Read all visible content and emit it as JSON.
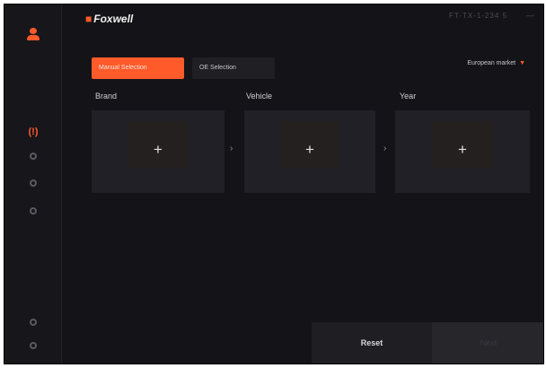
{
  "app": {
    "logo_text": "Foxwell"
  },
  "header": {
    "serial_text": "FT-TX-1-234 5",
    "window_control": "—"
  },
  "tabs": [
    {
      "label": "Manual Selection",
      "active": true
    },
    {
      "label": "OE Selection",
      "active": false
    }
  ],
  "region": {
    "label": "European market",
    "caret": "▼"
  },
  "columns": [
    {
      "label": "Brand",
      "icon": "+"
    },
    {
      "label": "Vehicle",
      "icon": "+"
    },
    {
      "label": "Year",
      "icon": "+"
    }
  ],
  "separators": [
    "›",
    "›"
  ],
  "footer": {
    "reset_label": "Reset",
    "next_label": "Next"
  },
  "colors": {
    "accent": "#ff5a2a",
    "background": "#141418",
    "panel": "#202026"
  }
}
